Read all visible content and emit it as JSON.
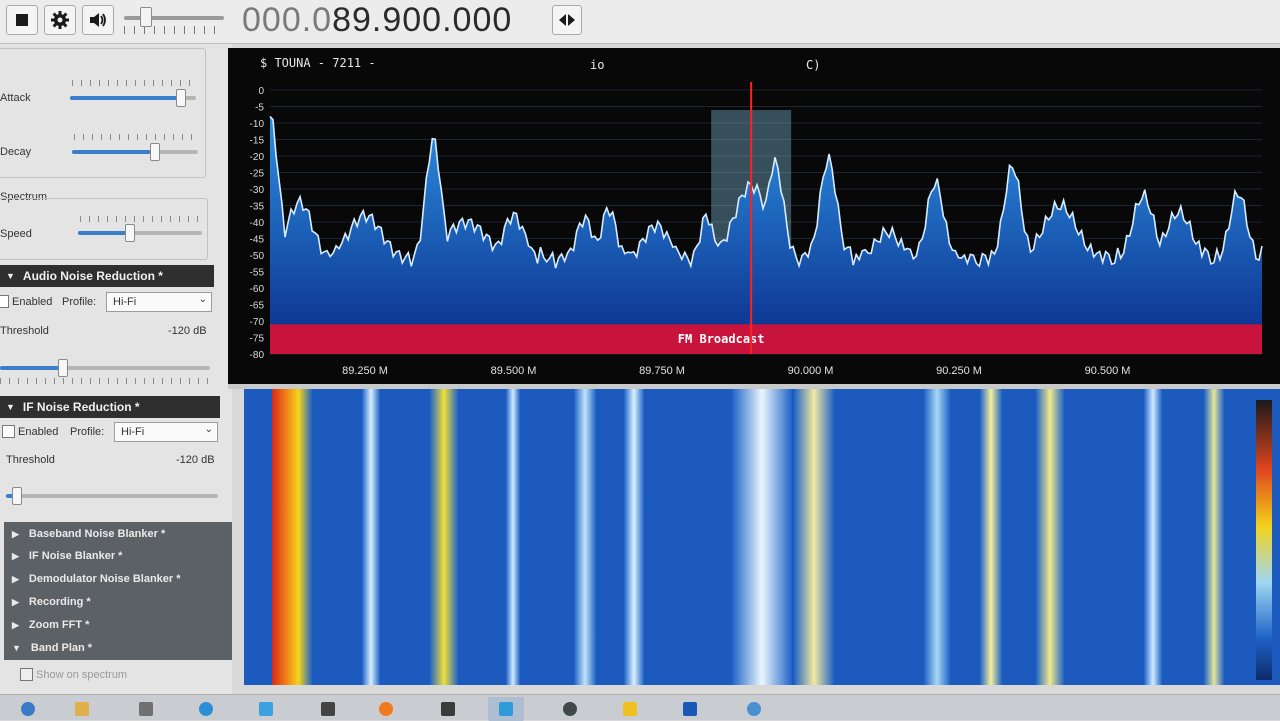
{
  "toolbar": {
    "frequency_prefix": "000.0",
    "frequency_main": "89.900.000",
    "volume_level": 0.22
  },
  "agc": {
    "attack_label": "Attack",
    "attack_level": 0.88,
    "decay_label": "Decay",
    "decay_level": 0.66
  },
  "spectrum_panel": {
    "group_label": "Spectrum",
    "speed_label": "Speed",
    "speed_level": 0.42
  },
  "audio_nr": {
    "title": "Audio Noise Reduction *",
    "enabled_label": "Enabled",
    "profile_label": "Profile:",
    "profile_value": "Hi-Fi",
    "threshold_label": "Threshold",
    "threshold_value": "-120 dB",
    "threshold_level": 0.3
  },
  "if_nr": {
    "title": "IF Noise Reduction *",
    "enabled_label": "Enabled",
    "profile_label": "Profile:",
    "profile_value": "Hi-Fi",
    "threshold_label": "Threshold",
    "threshold_value": "-120 dB",
    "threshold_level": 0.05
  },
  "collapsed_sections": [
    "Baseband Noise Blanker *",
    "IF Noise Blanker *",
    "Demodulator Noise Blanker *",
    "Recording *",
    "Zoom FFT *",
    "Band Plan *"
  ],
  "bandplan_option": "Show on spectrum",
  "spectrum": {
    "overlay_left": "$ TOUNA  - 7211 -",
    "overlay_mid": "io",
    "overlay_right": "C)",
    "band_label": "FM Broadcast",
    "db_ticks": [
      "0",
      "-5",
      "-10",
      "-15",
      "-20",
      "-25",
      "-30",
      "-35",
      "-40",
      "-45",
      "-50",
      "-55",
      "-60",
      "-65",
      "-70",
      "-75",
      "-80"
    ],
    "freq_ticks": [
      "89.250 M",
      "89.500 M",
      "89.750 M",
      "90.000 M",
      "90.250 M",
      "90.500 M"
    ],
    "tuned_frequency_mhz": 89.9,
    "visible_range_mhz": [
      89.09,
      90.76
    ],
    "colors": {
      "trace": "#d7ecff",
      "fill_top": "#2d8fe0",
      "fill_bottom": "#0a2c8a",
      "band": "#c8143c",
      "tuner_line": "#ff2020",
      "passband": "#8fd4f5"
    }
  },
  "taskbar": {
    "icons": [
      "start-icon",
      "explorer-icon",
      "device-icon",
      "browser-icon",
      "edge-icon",
      "calculator-icon",
      "firefox-icon",
      "app-icon",
      "sdr-icon",
      "terminal-icon",
      "bug-icon",
      "network-icon",
      "chrome-icon"
    ]
  }
}
